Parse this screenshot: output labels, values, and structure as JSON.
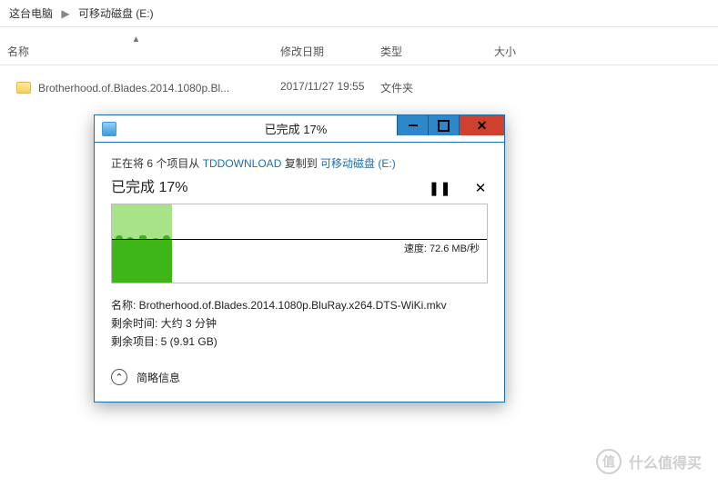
{
  "breadcrumb": {
    "root": "这台电脑",
    "leaf": "可移动磁盘 (E:)"
  },
  "columns": {
    "name": "名称",
    "date": "修改日期",
    "type": "类型",
    "size": "大小"
  },
  "files": [
    {
      "name": "Brotherhood.of.Blades.2014.1080p.Bl...",
      "date": "2017/11/27 19:55",
      "type": "文件夹",
      "size": ""
    }
  ],
  "dialog": {
    "title": "已完成 17%",
    "copy_prefix": "正在将 6 个项目从 ",
    "copy_src": "TDDOWNLOAD",
    "copy_mid": " 复制到 ",
    "copy_dst": "可移动磁盘 (E:)",
    "progress_title": "已完成 17%",
    "pause_glyph": "❚❚",
    "cancel_glyph": "✕",
    "speed": "速度: 72.6 MB/秒",
    "detail_name": "名称: Brotherhood.of.Blades.2014.1080p.BluRay.x264.DTS-WiKi.mkv",
    "detail_time": "剩余时间: 大约 3 分钟",
    "detail_items": "剩余项目: 5 (9.91 GB)",
    "toggle_label": "简略信息",
    "toggle_glyph": "⌃"
  },
  "watermark": {
    "badge": "值",
    "text": "什么值得买"
  },
  "chart_data": {
    "type": "area",
    "title": "",
    "xlabel": "",
    "ylabel": "",
    "x_progress_percent": 17,
    "speed_line_value": 72.6,
    "speed_unit": "MB/秒",
    "series": [
      {
        "name": "transfer_speed",
        "values_approx_mb_s": [
          72.6
        ]
      }
    ],
    "ylim": [
      0,
      170
    ]
  }
}
